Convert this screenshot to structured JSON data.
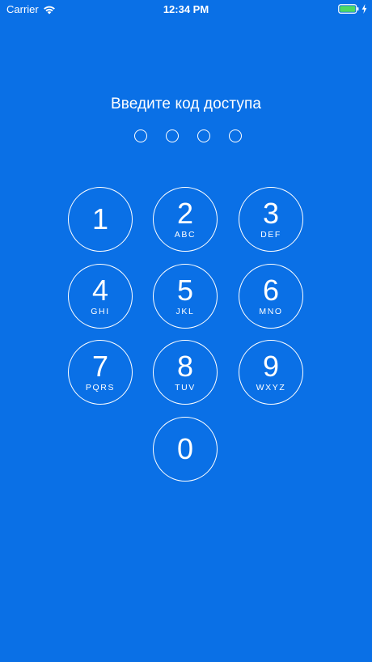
{
  "status_bar": {
    "carrier": "Carrier",
    "time": "12:34 PM",
    "wifi_icon": "wifi-icon",
    "battery_icon": "battery-full-icon",
    "charging_icon": "charging-bolt-icon",
    "battery_level": 1.0
  },
  "prompt": {
    "title": "Введите код доступа"
  },
  "passcode": {
    "length": 4,
    "entered": 0
  },
  "keypad": {
    "keys": [
      {
        "digit": "1",
        "letters": ""
      },
      {
        "digit": "2",
        "letters": "ABC"
      },
      {
        "digit": "3",
        "letters": "DEF"
      },
      {
        "digit": "4",
        "letters": "GHI"
      },
      {
        "digit": "5",
        "letters": "JKL"
      },
      {
        "digit": "6",
        "letters": "MNO"
      },
      {
        "digit": "7",
        "letters": "PQRS"
      },
      {
        "digit": "8",
        "letters": "TUV"
      },
      {
        "digit": "9",
        "letters": "WXYZ"
      },
      {
        "digit": "0",
        "letters": ""
      }
    ]
  },
  "colors": {
    "background": "#0a70e6",
    "foreground": "#ffffff",
    "battery_fill": "#4cd964"
  }
}
